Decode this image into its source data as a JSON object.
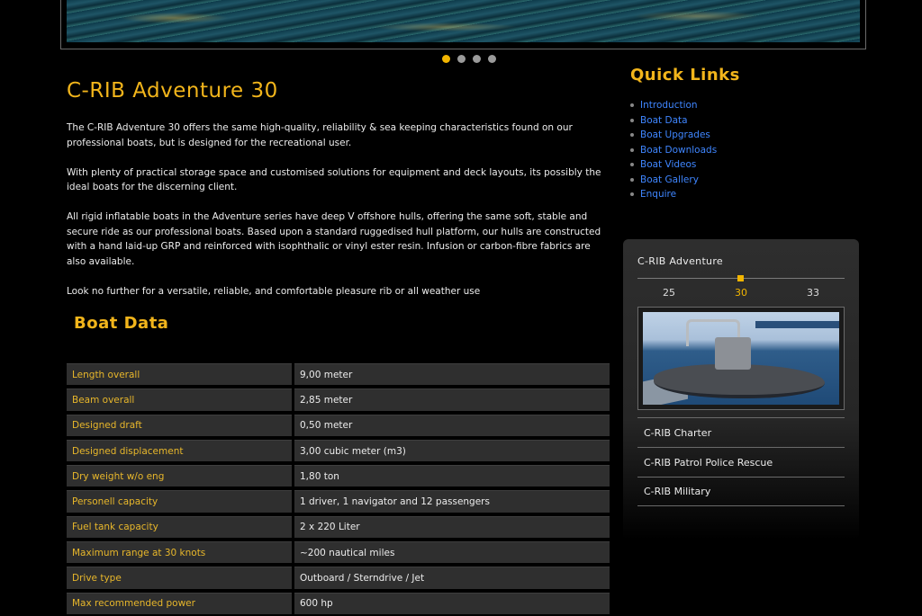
{
  "hero": {
    "slides": 4,
    "active_slide": 1,
    "accent": "#f2b500"
  },
  "main": {
    "title": "C-RIB Adventure 30",
    "paragraphs": [
      "The C-RIB Adventure 30 offers the same high-quality, reliability & sea keeping characteristics found on our professional boats, but is designed for the recreational user.",
      "With plenty of practical storage space and customised solutions for equipment and deck layouts, its possibly the ideal boats for the discerning client.",
      "All rigid inflatable boats in the Adventure series have deep V offshore hulls, offering the same soft, stable and secure ride as our professional boats. Based upon a standard ruggedised hull platform, our hulls are constructed with a hand laid-up GRP and reinforced with isophthalic or vinyl ester resin.  Infusion or carbon-fibre fabrics are also available.",
      "Look no further for a versatile, reliable, and comfortable pleasure rib or all weather use"
    ],
    "boat_data_title": "Boat Data",
    "boat_data": [
      {
        "label": "Length overall",
        "value": "9,00 meter"
      },
      {
        "label": "Beam overall",
        "value": "2,85 meter"
      },
      {
        "label": "Designed draft",
        "value": "0,50 meter"
      },
      {
        "label": "Designed displacement",
        "value": "3,00 cubic meter (m3)"
      },
      {
        "label": "Dry weight w/o eng",
        "value": "1,80 ton"
      },
      {
        "label": "Personell capacity",
        "value": "1 driver, 1 navigator and 12 passengers"
      },
      {
        "label": "Fuel tank capacity",
        "value": "2 x 220 Liter"
      },
      {
        "label": "Maximum range at 30 knots",
        "value": "~200 nautical miles"
      },
      {
        "label": "Drive type",
        "value": "Outboard / Sterndrive / Jet"
      },
      {
        "label": "Max recommended power",
        "value": "600 hp"
      }
    ]
  },
  "sidebar": {
    "quick_links_title": "Quick Links",
    "quick_links": [
      "Introduction",
      "Boat Data",
      "Boat Upgrades",
      "Boat Downloads",
      "Boat Videos",
      "Boat Gallery",
      "Enquire"
    ],
    "panel": {
      "title": "C-RIB Adventure",
      "models": [
        "25",
        "30",
        "33"
      ],
      "selected_model": "30",
      "links": [
        "C-RIB Charter",
        "C-RIB Patrol Police Rescue",
        "C-RIB Military"
      ]
    }
  },
  "colors": {
    "heading": "#f2b51b",
    "link": "#3f86ff",
    "label": "#e8b72b",
    "row_bg": "#2f2f2f"
  }
}
